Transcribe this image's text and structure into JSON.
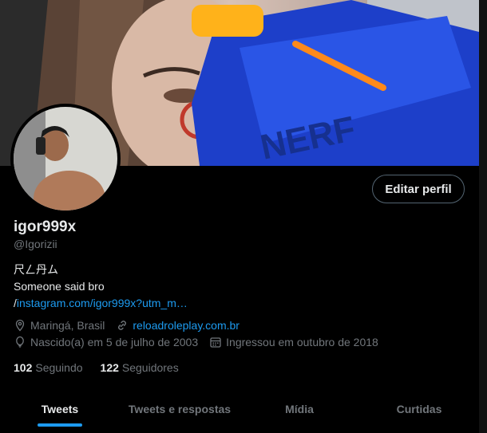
{
  "profile": {
    "display_name": "igor999x",
    "handle": "@Igorizii",
    "bio_line1": "尺ㄥ丹ム",
    "bio_line2": "Someone said bro",
    "bio_link_prefix": "/",
    "bio_link": "instagram.com/igor999x?utm_m…",
    "location": "Maringá, Brasil",
    "website": "reloadroleplay.com.br",
    "birthday": "Nascido(a) em 5 de julho de 2003",
    "joined": "Ingressou em outubro de 2018",
    "following_count": "102",
    "following_label": "Seguindo",
    "followers_count": "122",
    "followers_label": "Seguidores"
  },
  "actions": {
    "edit_profile": "Editar perfil"
  },
  "tabs": [
    {
      "label": "Tweets",
      "active": true
    },
    {
      "label": "Tweets e respostas",
      "active": false
    },
    {
      "label": "Mídia",
      "active": false
    },
    {
      "label": "Curtidas",
      "active": false
    }
  ],
  "colors": {
    "accent": "#1d9bf0",
    "secondary_text": "#71767b",
    "background": "#000000"
  },
  "icons": [
    "location-icon",
    "link-icon",
    "balloon-icon",
    "calendar-icon"
  ]
}
